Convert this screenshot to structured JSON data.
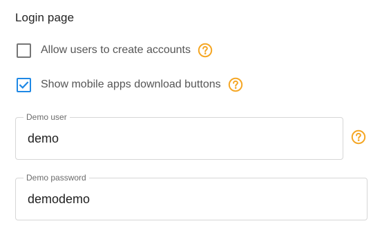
{
  "section": {
    "title": "Login page"
  },
  "options": [
    {
      "label": "Allow users to create accounts",
      "checked": false,
      "help_icon": "question-circle"
    },
    {
      "label": "Show mobile apps download buttons",
      "checked": true,
      "help_icon": "question-circle"
    }
  ],
  "fields": {
    "demo_user": {
      "label": "Demo user",
      "value": "demo",
      "help_icon": "question-circle"
    },
    "demo_password": {
      "label": "Demo password",
      "value": "demodemo"
    }
  },
  "colors": {
    "accent_checkbox": "#1e88e5",
    "help_icon": "#f5a623",
    "unchecked_border": "#757575"
  }
}
